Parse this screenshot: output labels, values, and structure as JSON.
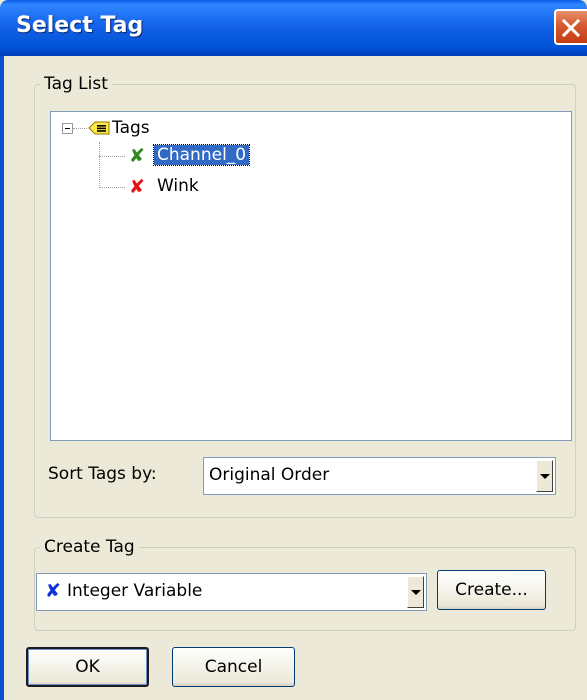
{
  "dialog": {
    "title": "Select Tag",
    "close_icon": "close-icon"
  },
  "tag_list": {
    "legend": "Tag List",
    "tree": {
      "root_label": "Tags",
      "root_icon": "tag-folder-icon",
      "children": [
        {
          "label": "Channel_0",
          "icon": "green-x-icon",
          "icon_color": "#2e8b1e",
          "selected": true
        },
        {
          "label": "Wink",
          "icon": "red-x-icon",
          "icon_color": "#e41010",
          "selected": false
        }
      ]
    },
    "sort_label": "Sort Tags by:",
    "sort_value": "Original Order"
  },
  "create_tag": {
    "legend": "Create Tag",
    "type_value": "Integer Variable",
    "type_icon": "blue-x-icon",
    "type_icon_color": "#1030e0",
    "create_button": "Create..."
  },
  "buttons": {
    "ok": "OK",
    "cancel": "Cancel"
  },
  "colors": {
    "titlebar": "#0054e3",
    "selection": "#316ac5",
    "dialog_bg": "#ece9d8"
  }
}
